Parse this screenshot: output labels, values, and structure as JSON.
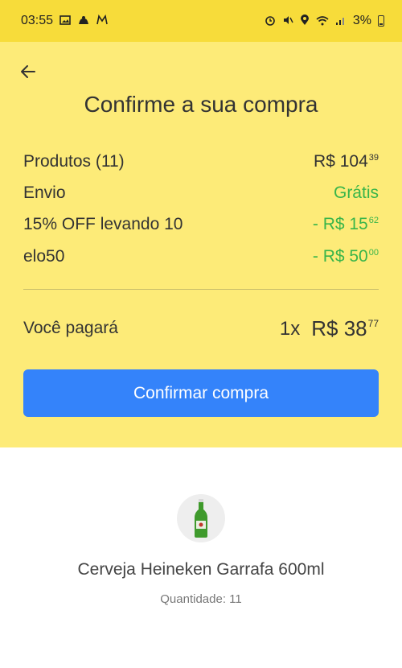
{
  "status_bar": {
    "time": "03:55",
    "left_icons": [
      "image-icon",
      "app-icon",
      "gmail-icon"
    ],
    "right_icons": [
      "alarm-icon",
      "mute-icon",
      "location-icon",
      "wifi-icon",
      "signal-icon"
    ],
    "battery": "3%"
  },
  "header": {
    "back_icon": "arrow-left-icon",
    "title": "Confirme a sua compra",
    "background": "#fdeb78"
  },
  "summary": {
    "rows": [
      {
        "label": "Produtos (11)",
        "value": "R$ 104",
        "cents": "39",
        "color": "default"
      },
      {
        "label": "Envio",
        "value": "Grátis",
        "cents": "",
        "color": "green"
      },
      {
        "label": "15% OFF levando 10",
        "value": "- R$ 15",
        "cents": "62",
        "color": "green"
      },
      {
        "label": "elo50",
        "value": "- R$ 50",
        "cents": "00",
        "color": "green"
      }
    ]
  },
  "total": {
    "label": "Você pagará",
    "quantity": "1x",
    "value": "R$ 38",
    "cents": "77"
  },
  "confirm_button": {
    "label": "Confirmar compra",
    "color": "#3483fa"
  },
  "product": {
    "name": "Cerveja Heineken Garrafa 600ml",
    "quantity_text": "Quantidade: 11",
    "image_icon": "beer-bottle-icon"
  },
  "colors": {
    "status_bar": "#f7dc3a",
    "accent_green": "#39b54a"
  }
}
